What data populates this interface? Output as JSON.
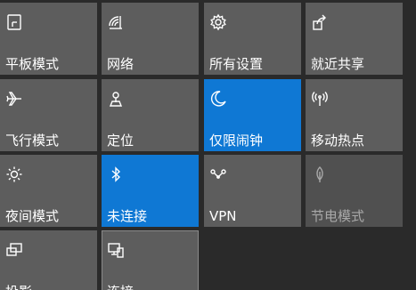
{
  "action_center": {
    "tiles": [
      {
        "label": "平板模式",
        "icon": "tablet-mode-icon",
        "state": "off"
      },
      {
        "label": "网络",
        "icon": "network-icon",
        "state": "off"
      },
      {
        "label": "所有设置",
        "icon": "gear-icon",
        "state": "off"
      },
      {
        "label": "就近共享",
        "icon": "nearby-share-icon",
        "state": "off"
      },
      {
        "label": "飞行模式",
        "icon": "airplane-icon",
        "state": "off"
      },
      {
        "label": "定位",
        "icon": "location-icon",
        "state": "off"
      },
      {
        "label": "仅限闹钟",
        "icon": "moon-icon",
        "state": "on"
      },
      {
        "label": "移动热点",
        "icon": "hotspot-icon",
        "state": "off"
      },
      {
        "label": "夜间模式",
        "icon": "brightness-icon",
        "state": "off"
      },
      {
        "label": "未连接",
        "icon": "bluetooth-icon",
        "state": "on"
      },
      {
        "label": "VPN",
        "icon": "vpn-icon",
        "state": "off"
      },
      {
        "label": "节电模式",
        "icon": "battery-saver-icon",
        "state": "disabled"
      },
      {
        "label": "投影",
        "icon": "project-icon",
        "state": "off"
      },
      {
        "label": "连接",
        "icon": "connect-icon",
        "state": "off"
      }
    ],
    "colors": {
      "background": "#2a2a2a",
      "tile": "#5d5d5d",
      "tile_active": "#0f78d4",
      "tile_disabled": "#505050",
      "text": "#ffffff",
      "text_disabled": "#a8a8a8"
    }
  }
}
